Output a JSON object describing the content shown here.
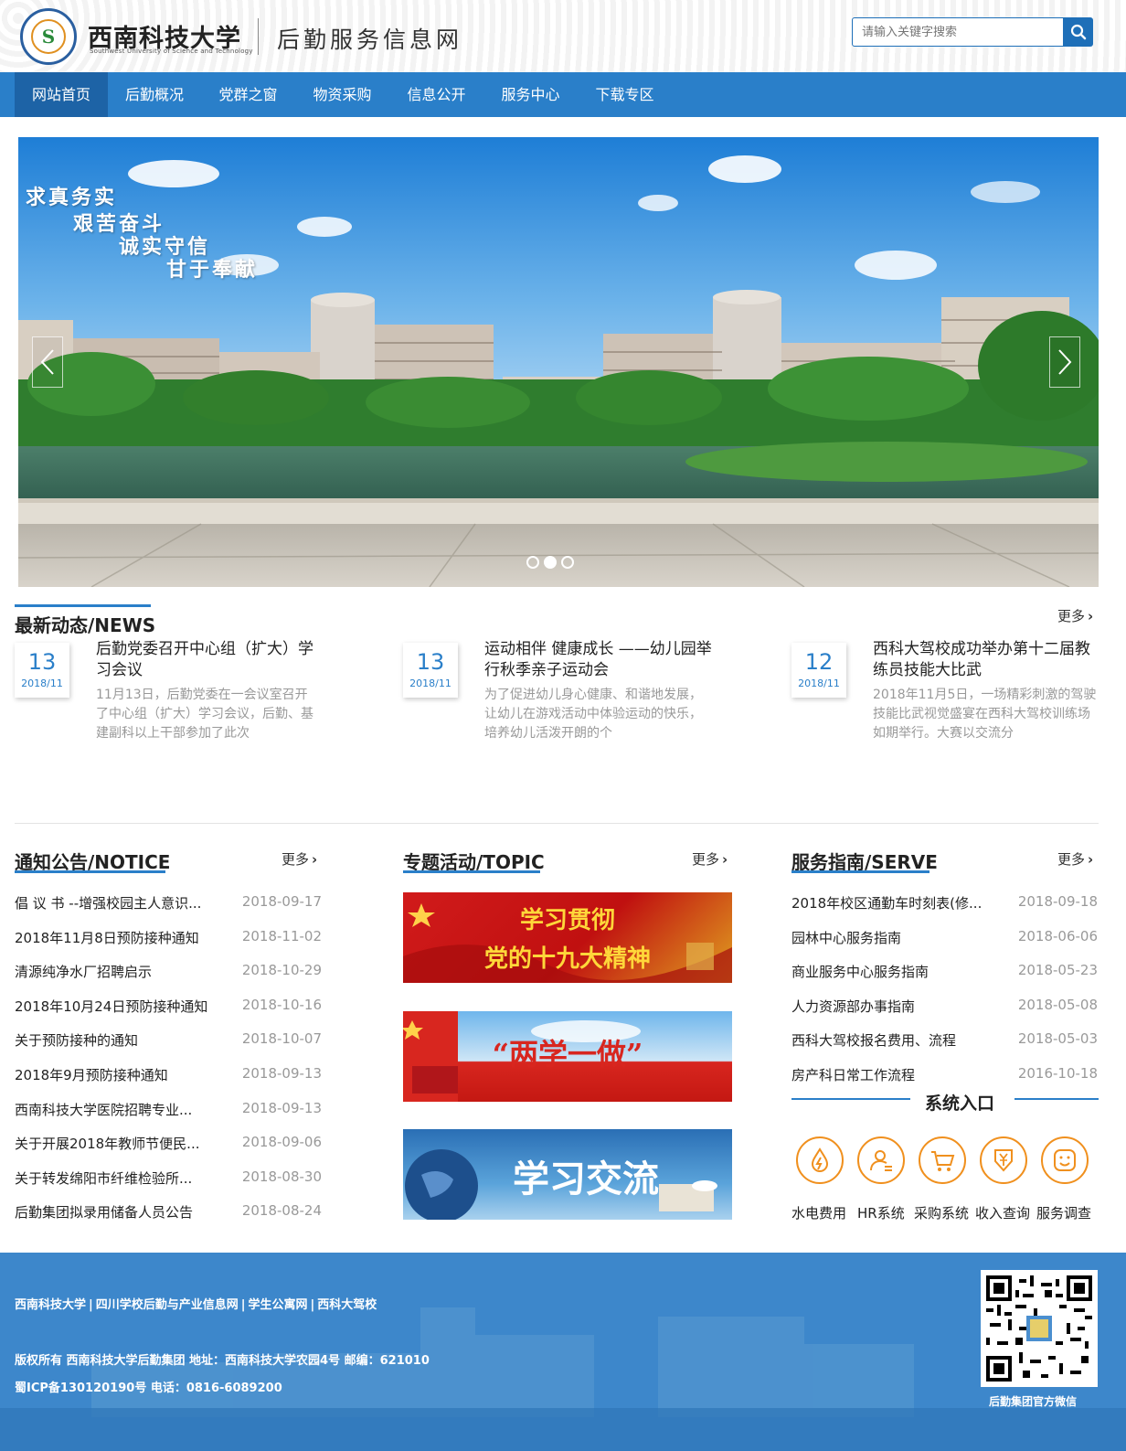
{
  "header": {
    "logo_glyph": "S",
    "university_name": "西南科技大学",
    "university_en": "Southwest University of Science and Technology",
    "site_title": "后勤服务信息网",
    "search_placeholder": "请输入关键字搜索"
  },
  "nav": {
    "items": [
      {
        "label": "网站首页",
        "active": true
      },
      {
        "label": "后勤概况"
      },
      {
        "label": "党群之窗"
      },
      {
        "label": "物资采购"
      },
      {
        "label": "信息公开"
      },
      {
        "label": "服务中心"
      },
      {
        "label": "下载专区"
      }
    ]
  },
  "banner": {
    "slogans": [
      "求真务实",
      "艰苦奋斗",
      "诚实守信",
      "甘于奉献"
    ],
    "slides": 3,
    "active_slide": 2
  },
  "news": {
    "title": "最新动态/NEWS",
    "more": "更多",
    "items": [
      {
        "day": "13",
        "month": "2018/11",
        "title": "后勤党委召开中心组（扩大）学习会议",
        "desc": "11月13日，后勤党委在一会议室召开了中心组（扩大）学习会议，后勤、基建副科以上干部参加了此次"
      },
      {
        "day": "13",
        "month": "2018/11",
        "title": "运动相伴 健康成长 ——幼儿园举行秋季亲子运动会",
        "desc": "为了促进幼儿身心健康、和谐地发展，让幼儿在游戏活动中体验运动的快乐，培养幼儿活泼开朗的个"
      },
      {
        "day": "12",
        "month": "2018/11",
        "title": "西科大驾校成功举办第十二届教练员技能大比武",
        "desc": "2018年11月5日，一场精彩刺激的驾驶技能比武视觉盛宴在西科大驾校训练场如期举行。大赛以交流分"
      }
    ]
  },
  "notice": {
    "title": "通知公告/NOTICE",
    "more": "更多",
    "items": [
      {
        "t": "倡 议 书 --增强校园主人意识...",
        "d": "2018-09-17"
      },
      {
        "t": "2018年11月8日预防接种通知",
        "d": "2018-11-02"
      },
      {
        "t": "清源纯净水厂招聘启示",
        "d": "2018-10-29"
      },
      {
        "t": "2018年10月24日预防接种通知",
        "d": "2018-10-16"
      },
      {
        "t": "关于预防接种的通知",
        "d": "2018-10-07"
      },
      {
        "t": "2018年9月预防接种通知",
        "d": "2018-09-13"
      },
      {
        "t": "西南科技大学医院招聘专业...",
        "d": "2018-09-13"
      },
      {
        "t": "关于开展2018年教师节便民...",
        "d": "2018-09-06"
      },
      {
        "t": "关于转发绵阳市纤维检验所...",
        "d": "2018-08-30"
      },
      {
        "t": "后勤集团拟录用储备人员公告",
        "d": "2018-08-24"
      }
    ]
  },
  "topic": {
    "title": "专题活动/TOPIC",
    "more": "更多",
    "banners": [
      {
        "line1": "学习贯彻",
        "line2": "党的十九大精神"
      },
      {
        "line1": "“两学一做”"
      },
      {
        "line1": "学习交流"
      }
    ]
  },
  "serve": {
    "title": "服务指南/SERVE",
    "more": "更多",
    "items": [
      {
        "t": "2018年校区通勤车时刻表(修...",
        "d": "2018-09-18"
      },
      {
        "t": "园林中心服务指南",
        "d": "2018-06-06"
      },
      {
        "t": "商业服务中心服务指南",
        "d": "2018-05-23"
      },
      {
        "t": "人力资源部办事指南",
        "d": "2018-05-08"
      },
      {
        "t": "西科大驾校报名费用、流程",
        "d": "2018-05-03"
      },
      {
        "t": "房产科日常工作流程",
        "d": "2016-10-18"
      }
    ]
  },
  "system": {
    "title": "系统入口",
    "items": [
      {
        "label": "水电费用",
        "icon": "bolt-drop-icon"
      },
      {
        "label": "HR系统",
        "icon": "user-icon"
      },
      {
        "label": "采购系统",
        "icon": "cart-icon"
      },
      {
        "label": "收入查询",
        "icon": "yen-icon"
      },
      {
        "label": "服务调查",
        "icon": "smile-icon"
      }
    ]
  },
  "footer": {
    "links": [
      "西南科技大学",
      "四川学校后勤与产业信息网",
      "学生公寓网",
      "西科大驾校"
    ],
    "line1": "版权所有 西南科技大学后勤集团 地址：西南科技大学农园4号 邮编：621010",
    "line2": "蜀ICP备130120190号 电话：0816-6089200",
    "qr_label": "后勤集团官方微信"
  },
  "colors": {
    "primary": "#2a7fc9",
    "primary_dark": "#1d63a6",
    "accent": "#f0901e"
  }
}
